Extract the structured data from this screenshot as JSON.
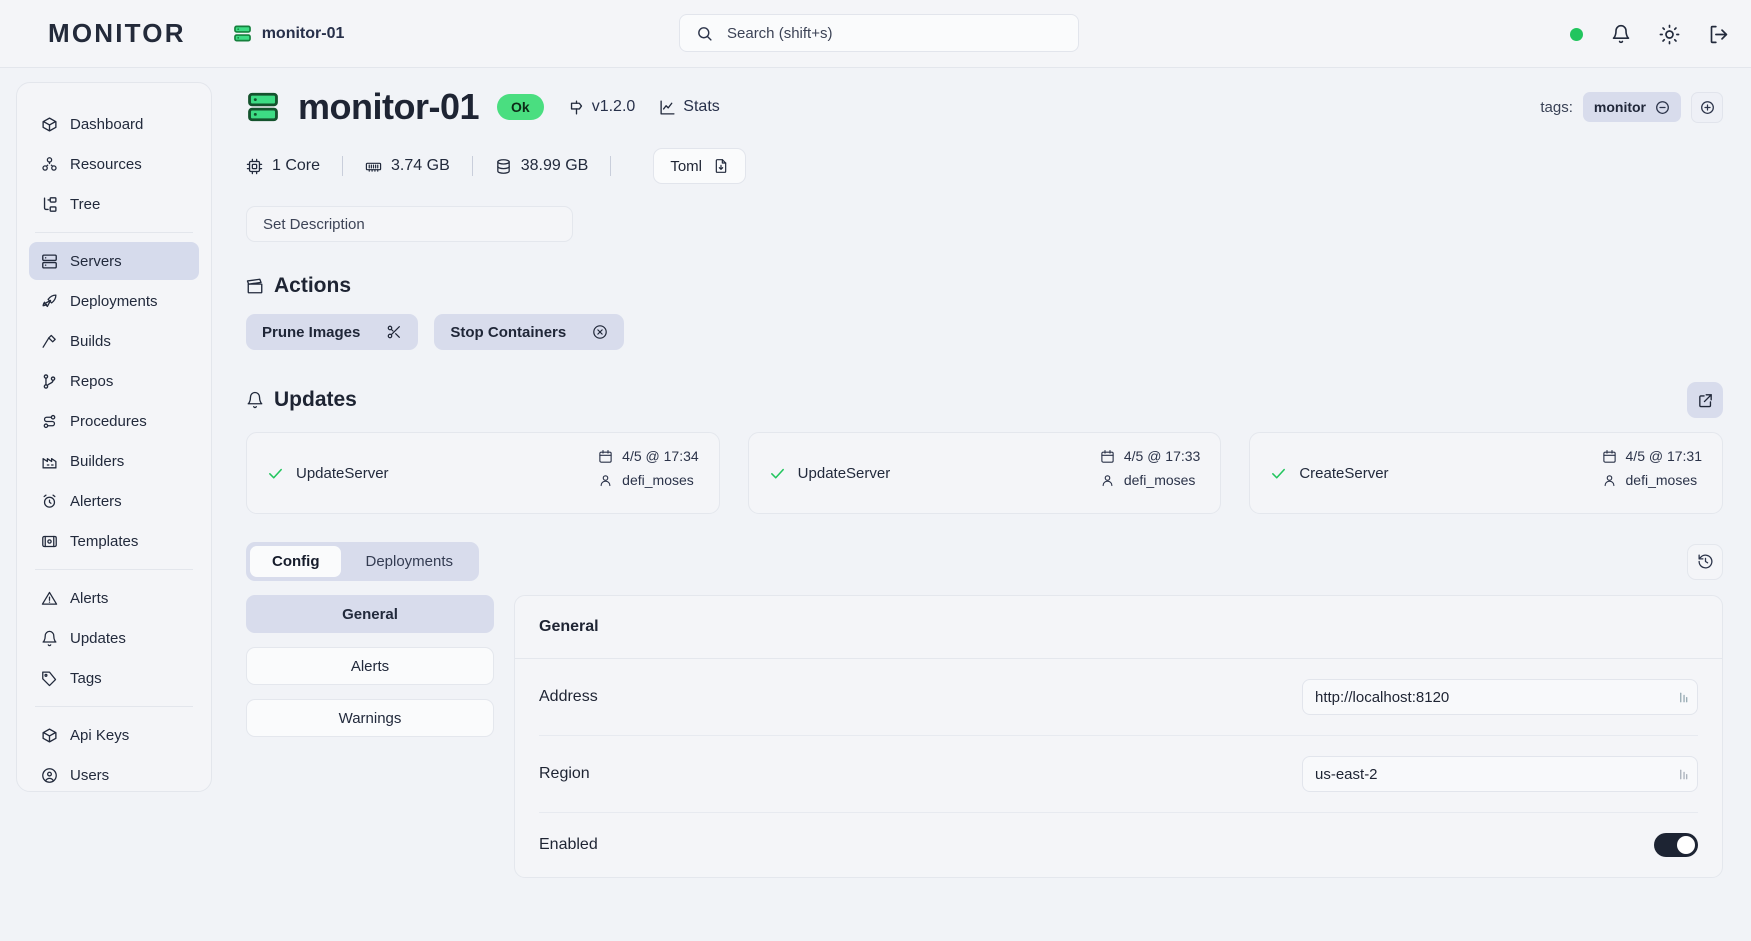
{
  "header": {
    "brand": "MONITOR",
    "breadcrumb": "monitor-01",
    "breadcrumb_icon": "server-icon",
    "search": {
      "placeholder": "Search (shift+s)",
      "icon": "search-icon"
    },
    "status_indicator": "status-dot-online",
    "icons": [
      "bell-icon",
      "sun-icon",
      "logout-icon"
    ],
    "accent_green": "#22c55e"
  },
  "sidebar": {
    "groups": [
      {
        "items": [
          {
            "label": "Dashboard",
            "icon": "box-icon",
            "active": false
          },
          {
            "label": "Resources",
            "icon": "resources-icon",
            "active": false
          },
          {
            "label": "Tree",
            "icon": "tree-icon",
            "active": false
          }
        ]
      },
      {
        "items": [
          {
            "label": "Servers",
            "icon": "server-icon",
            "active": true
          },
          {
            "label": "Deployments",
            "icon": "rocket-icon",
            "active": false
          },
          {
            "label": "Builds",
            "icon": "hammer-icon",
            "active": false
          },
          {
            "label": "Repos",
            "icon": "git-branch-icon",
            "active": false
          },
          {
            "label": "Procedures",
            "icon": "workflow-icon",
            "active": false
          },
          {
            "label": "Builders",
            "icon": "factory-icon",
            "active": false
          },
          {
            "label": "Alerters",
            "icon": "alarm-clock-icon",
            "active": false
          },
          {
            "label": "Templates",
            "icon": "template-icon",
            "active": false
          }
        ]
      },
      {
        "items": [
          {
            "label": "Alerts",
            "icon": "warning-triangle-icon",
            "active": false
          },
          {
            "label": "Updates",
            "icon": "bell-icon",
            "active": false
          },
          {
            "label": "Tags",
            "icon": "tag-icon",
            "active": false
          }
        ]
      },
      {
        "items": [
          {
            "label": "Api Keys",
            "icon": "box-icon",
            "active": false
          },
          {
            "label": "Users",
            "icon": "user-circle-icon",
            "active": false
          }
        ]
      }
    ]
  },
  "page": {
    "icon": "server-icon",
    "title": "monitor-01",
    "status_badge": "Ok",
    "status_badge_color": "#4ade80",
    "version": "v1.2.0",
    "version_icon": "milestone-icon",
    "stats_label": "Stats",
    "stats_icon": "chart-icon",
    "tags_label": "tags:",
    "tags": [
      {
        "name": "monitor",
        "remove_icon": "minus-circle-icon"
      }
    ],
    "add_tag_icon": "plus-circle-icon",
    "metrics": [
      {
        "value": "1 Core",
        "icon": "cpu-icon"
      },
      {
        "value": "3.74 GB",
        "icon": "memory-icon"
      },
      {
        "value": "38.99 GB",
        "icon": "disk-icon"
      }
    ],
    "toml_button": {
      "label": "Toml",
      "icon": "file-download-icon"
    },
    "description_placeholder": "Set Description"
  },
  "actions": {
    "heading": "Actions",
    "heading_icon": "clapperboard-icon",
    "buttons": [
      {
        "label": "Prune Images",
        "icon": "scissors-icon"
      },
      {
        "label": "Stop Containers",
        "icon": "circle-x-icon"
      }
    ]
  },
  "updates": {
    "heading": "Updates",
    "heading_icon": "bell-icon",
    "external_icon": "external-link-icon",
    "cards": [
      {
        "status_icon": "check-icon",
        "name": "UpdateServer",
        "date": "4/5 @ 17:34",
        "date_icon": "calendar-icon",
        "user": "defi_moses",
        "user_icon": "user-icon"
      },
      {
        "status_icon": "check-icon",
        "name": "UpdateServer",
        "date": "4/5 @ 17:33",
        "date_icon": "calendar-icon",
        "user": "defi_moses",
        "user_icon": "user-icon"
      },
      {
        "status_icon": "check-icon",
        "name": "CreateServer",
        "date": "4/5 @ 17:31",
        "date_icon": "calendar-icon",
        "user": "defi_moses",
        "user_icon": "user-icon"
      }
    ]
  },
  "config": {
    "tabs": [
      {
        "label": "Config",
        "active": true
      },
      {
        "label": "Deployments",
        "active": false
      }
    ],
    "history_icon": "history-icon",
    "sections": [
      {
        "label": "General",
        "active": true
      },
      {
        "label": "Alerts",
        "active": false
      },
      {
        "label": "Warnings",
        "active": false
      }
    ],
    "panel_title": "General",
    "fields": [
      {
        "label": "Address",
        "type": "text",
        "value": "http://localhost:8120",
        "grip_icon": "resize-grip-icon"
      },
      {
        "label": "Region",
        "type": "text",
        "value": "us-east-2",
        "grip_icon": "resize-grip-icon"
      },
      {
        "label": "Enabled",
        "type": "toggle",
        "value": "on"
      }
    ]
  }
}
